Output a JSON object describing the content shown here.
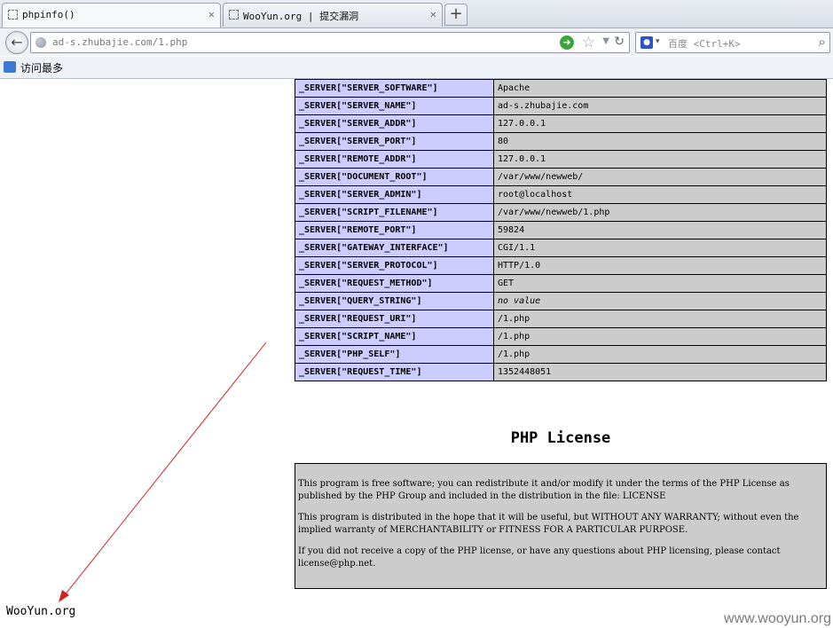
{
  "tabs": [
    {
      "label": "phpinfo()",
      "close": "✕"
    },
    {
      "label": "WooYun.org | 提交漏洞",
      "close": "✕"
    }
  ],
  "new_tab_label": "+",
  "navbar": {
    "back_icon": "←",
    "url": "ad-s.zhubajie.com/1.php",
    "go_icon": "➜",
    "star_icon": "☆",
    "dropdown_icon": "▼",
    "reload_icon": "↻"
  },
  "search": {
    "engine_icon": "🐾",
    "dropdown_icon": "▾",
    "placeholder": "百度 <Ctrl+K>",
    "search_icon": "🔍"
  },
  "bookmarks": {
    "most_visited": "访问最多"
  },
  "server_rows": [
    {
      "key": "_SERVER[\"SERVER_SOFTWARE\"]",
      "value": "Apache"
    },
    {
      "key": "_SERVER[\"SERVER_NAME\"]",
      "value": "ad-s.zhubajie.com"
    },
    {
      "key": "_SERVER[\"SERVER_ADDR\"]",
      "value": "127.0.0.1"
    },
    {
      "key": "_SERVER[\"SERVER_PORT\"]",
      "value": "80"
    },
    {
      "key": "_SERVER[\"REMOTE_ADDR\"]",
      "value": "127.0.0.1"
    },
    {
      "key": "_SERVER[\"DOCUMENT_ROOT\"]",
      "value": "/var/www/newweb/"
    },
    {
      "key": "_SERVER[\"SERVER_ADMIN\"]",
      "value": "root@localhost"
    },
    {
      "key": "_SERVER[\"SCRIPT_FILENAME\"]",
      "value": "/var/www/newweb/1.php"
    },
    {
      "key": "_SERVER[\"REMOTE_PORT\"]",
      "value": "59824"
    },
    {
      "key": "_SERVER[\"GATEWAY_INTERFACE\"]",
      "value": "CGI/1.1"
    },
    {
      "key": "_SERVER[\"SERVER_PROTOCOL\"]",
      "value": "HTTP/1.0"
    },
    {
      "key": "_SERVER[\"REQUEST_METHOD\"]",
      "value": "GET"
    },
    {
      "key": "_SERVER[\"QUERY_STRING\"]",
      "value": "no value",
      "italic": true
    },
    {
      "key": "_SERVER[\"REQUEST_URI\"]",
      "value": "/1.php"
    },
    {
      "key": "_SERVER[\"SCRIPT_NAME\"]",
      "value": "/1.php"
    },
    {
      "key": "_SERVER[\"PHP_SELF\"]",
      "value": "/1.php"
    },
    {
      "key": "_SERVER[\"REQUEST_TIME\"]",
      "value": "1352448051"
    }
  ],
  "license": {
    "heading": "PHP License",
    "paragraphs": [
      "This program is free software; you can redistribute it and/or modify it under the terms of the PHP License as published by the PHP Group and included in the distribution in the file: LICENSE",
      "This program is distributed in the hope that it will be useful, but WITHOUT ANY WARRANTY; without even the implied warranty of MERCHANTABILITY or FITNESS FOR A PARTICULAR PURPOSE.",
      "If you did not receive a copy of the PHP license, or have any questions about PHP licensing, please contact license@php.net."
    ]
  },
  "annotation": {
    "label": "WooYun.org",
    "arrow_color": "#d42020"
  },
  "watermark": "www.wooyun.org"
}
